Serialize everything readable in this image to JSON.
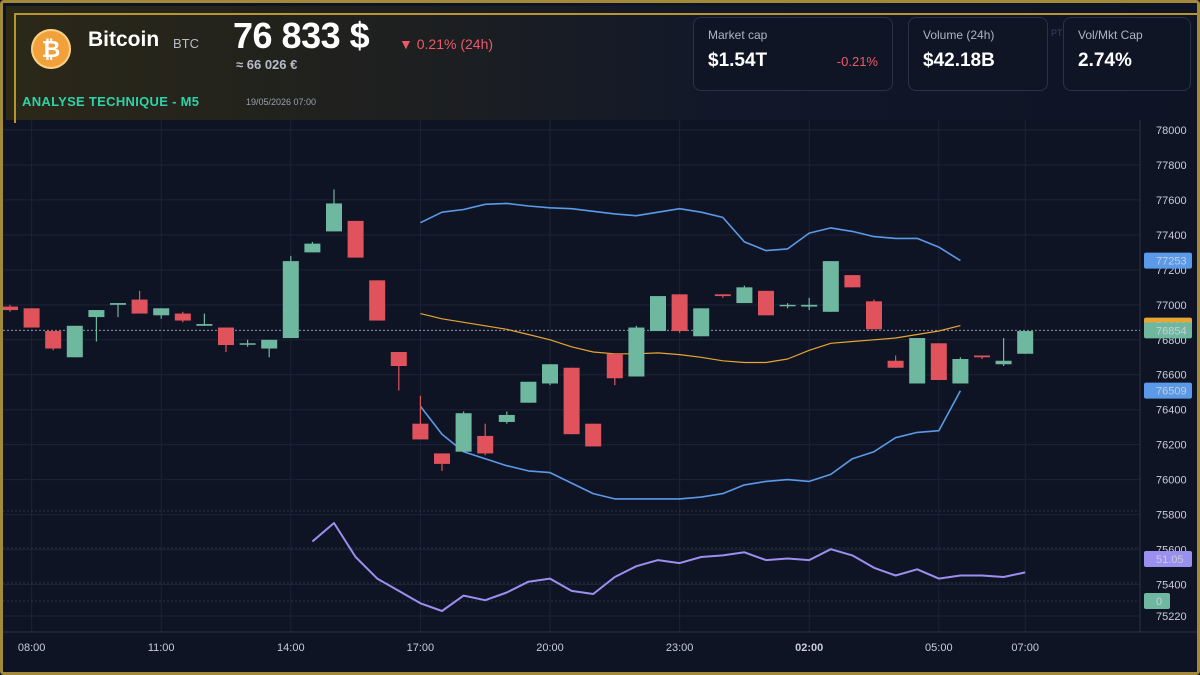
{
  "header": {
    "coin_name": "Bitcoin",
    "coin_symbol": "BTC",
    "icon": "bitcoin-icon",
    "price": "76 833 $",
    "change": "▼ 0.21% (24h)",
    "price_eur": "≈ 66 026 €",
    "section_title": "ANALYSE TECHNIQUE - M5",
    "timestamp": "19/05/2026 07:00"
  },
  "cards": [
    {
      "label": "Market cap",
      "value": "$1.54T",
      "sub": "-0.21%"
    },
    {
      "label": "Volume (24h)",
      "value": "$42.18B",
      "sub": ""
    },
    {
      "label": "Vol/Mkt Cap",
      "value": "2.74%",
      "sub": ""
    }
  ],
  "ghost_text": "PTC",
  "colors": {
    "up": "#6fb8a0",
    "down": "#e0535c",
    "band": "#5b9ae8",
    "ma": "#e8a531",
    "rsi": "#9b8ff0",
    "accent": "#b8952e"
  },
  "chart_data": {
    "type": "candlestick",
    "x_tick_labels": [
      "08:00",
      "11:00",
      "14:00",
      "17:00",
      "20:00",
      "23:00",
      "02:00",
      "05:00",
      "07:00"
    ],
    "x_tick_index": [
      1,
      7,
      13,
      19,
      25,
      31,
      37,
      43,
      47
    ],
    "y_tick_labels": [
      "78000",
      "77800",
      "77600",
      "77400",
      "77200",
      "77000",
      "76800",
      "76600",
      "76400",
      "76200",
      "76000",
      "75800",
      "75600",
      "75400",
      "75220"
    ],
    "ylim": [
      75220,
      78000
    ],
    "candles": [
      {
        "o": 76990,
        "h": 77000,
        "l": 76960,
        "c": 76970
      },
      {
        "o": 76980,
        "h": 76980,
        "l": 76870,
        "c": 76870
      },
      {
        "o": 76850,
        "h": 76850,
        "l": 76740,
        "c": 76750
      },
      {
        "o": 76700,
        "h": 76880,
        "l": 76700,
        "c": 76880
      },
      {
        "o": 76930,
        "h": 76970,
        "l": 76790,
        "c": 76970
      },
      {
        "o": 77000,
        "h": 77010,
        "l": 76930,
        "c": 77010
      },
      {
        "o": 77030,
        "h": 77080,
        "l": 76960,
        "c": 76950
      },
      {
        "o": 76940,
        "h": 76980,
        "l": 76920,
        "c": 76980
      },
      {
        "o": 76950,
        "h": 76960,
        "l": 76900,
        "c": 76910
      },
      {
        "o": 76880,
        "h": 76950,
        "l": 76880,
        "c": 76890
      },
      {
        "o": 76870,
        "h": 76870,
        "l": 76730,
        "c": 76770
      },
      {
        "o": 76780,
        "h": 76800,
        "l": 76760,
        "c": 76780
      },
      {
        "o": 76750,
        "h": 76770,
        "l": 76700,
        "c": 76800
      },
      {
        "o": 76810,
        "h": 77280,
        "l": 76810,
        "c": 77250
      },
      {
        "o": 77300,
        "h": 77360,
        "l": 77300,
        "c": 77350
      },
      {
        "o": 77420,
        "h": 77660,
        "l": 77420,
        "c": 77580
      },
      {
        "o": 77480,
        "h": 77480,
        "l": 77270,
        "c": 77270
      },
      {
        "o": 77140,
        "h": 77140,
        "l": 76910,
        "c": 76910
      },
      {
        "o": 76730,
        "h": 76730,
        "l": 76510,
        "c": 76650
      },
      {
        "o": 76320,
        "h": 76480,
        "l": 76230,
        "c": 76230
      },
      {
        "o": 76150,
        "h": 76150,
        "l": 76050,
        "c": 76090
      },
      {
        "o": 76160,
        "h": 76390,
        "l": 76160,
        "c": 76380
      },
      {
        "o": 76250,
        "h": 76320,
        "l": 76140,
        "c": 76150
      },
      {
        "o": 76330,
        "h": 76390,
        "l": 76320,
        "c": 76370
      },
      {
        "o": 76440,
        "h": 76470,
        "l": 76440,
        "c": 76560
      },
      {
        "o": 76550,
        "h": 76660,
        "l": 76540,
        "c": 76660
      },
      {
        "o": 76640,
        "h": 76640,
        "l": 76260,
        "c": 76260
      },
      {
        "o": 76320,
        "h": 76320,
        "l": 76190,
        "c": 76190
      },
      {
        "o": 76720,
        "h": 76720,
        "l": 76540,
        "c": 76580
      },
      {
        "o": 76590,
        "h": 76880,
        "l": 76590,
        "c": 76870
      },
      {
        "o": 76850,
        "h": 77040,
        "l": 76850,
        "c": 77050
      },
      {
        "o": 77060,
        "h": 77060,
        "l": 76840,
        "c": 76850
      },
      {
        "o": 76820,
        "h": 76980,
        "l": 76820,
        "c": 76980
      },
      {
        "o": 77060,
        "h": 77060,
        "l": 77040,
        "c": 77050
      },
      {
        "o": 77010,
        "h": 77110,
        "l": 77010,
        "c": 77100
      },
      {
        "o": 77080,
        "h": 77080,
        "l": 76940,
        "c": 76940
      },
      {
        "o": 77000,
        "h": 77010,
        "l": 76980,
        "c": 77000
      },
      {
        "o": 76990,
        "h": 77040,
        "l": 76970,
        "c": 77000
      },
      {
        "o": 76960,
        "h": 77250,
        "l": 76960,
        "c": 77250
      },
      {
        "o": 77170,
        "h": 77170,
        "l": 77100,
        "c": 77100
      },
      {
        "o": 77020,
        "h": 77030,
        "l": 76860,
        "c": 76860
      },
      {
        "o": 76680,
        "h": 76710,
        "l": 76640,
        "c": 76640
      },
      {
        "o": 76550,
        "h": 76810,
        "l": 76550,
        "c": 76810
      },
      {
        "o": 76780,
        "h": 76780,
        "l": 76570,
        "c": 76570
      },
      {
        "o": 76550,
        "h": 76700,
        "l": 76550,
        "c": 76690
      },
      {
        "o": 76710,
        "h": 76710,
        "l": 76690,
        "c": 76700
      },
      {
        "o": 76660,
        "h": 76810,
        "l": 76650,
        "c": 76680
      },
      {
        "o": 76720,
        "h": 76850,
        "l": 76720,
        "c": 76850
      }
    ],
    "bollinger_start_index": 19,
    "bollinger_upper": [
      77470,
      77530,
      77545,
      77575,
      77580,
      77565,
      77555,
      77550,
      77535,
      77520,
      77510,
      77530,
      77550,
      77530,
      77500,
      77360,
      77310,
      77320,
      77410,
      77440,
      77420,
      77390,
      77380,
      77380,
      77330,
      77253
    ],
    "bollinger_middle": [
      76950,
      76920,
      76900,
      76880,
      76860,
      76830,
      76800,
      76760,
      76730,
      76720,
      76720,
      76725,
      76715,
      76700,
      76680,
      76670,
      76670,
      76690,
      76740,
      76780,
      76790,
      76800,
      76810,
      76830,
      76850,
      76881
    ],
    "bollinger_lower": [
      76420,
      76260,
      76160,
      76120,
      76080,
      76050,
      76040,
      75980,
      75920,
      75890,
      75890,
      75890,
      75890,
      75900,
      75920,
      75970,
      75990,
      76000,
      75990,
      76030,
      76120,
      76160,
      76240,
      76270,
      76280,
      76509
    ],
    "rsi_start_index": 14,
    "rsi": [
      75.8,
      77.0,
      74.8,
      73.4,
      72.6,
      71.8,
      71.3,
      72.3,
      72.0,
      72.5,
      73.2,
      73.4,
      72.6,
      72.4,
      73.5,
      74.2,
      74.6,
      74.4,
      74.8,
      74.9,
      75.1,
      74.6,
      74.7,
      74.6,
      75.3,
      74.9,
      74.1,
      73.6,
      74.0,
      73.4,
      73.6,
      73.6,
      73.5,
      73.8
    ],
    "markers": [
      {
        "label": "77253",
        "value": 77253,
        "color": "#5b9ae8"
      },
      {
        "label": "76881",
        "value": 76881,
        "color": "#e8a531"
      },
      {
        "label": "76854",
        "value": 76854,
        "color": "#6fb8a0"
      },
      {
        "label": "76509",
        "value": 76509,
        "color": "#5b9ae8"
      },
      {
        "label": "51.05",
        "value": 75550,
        "color": "#9b8ff0"
      },
      {
        "label": "0",
        "value": 75280,
        "color": "#6fb8a0"
      }
    ],
    "current_price_line": 76854
  }
}
